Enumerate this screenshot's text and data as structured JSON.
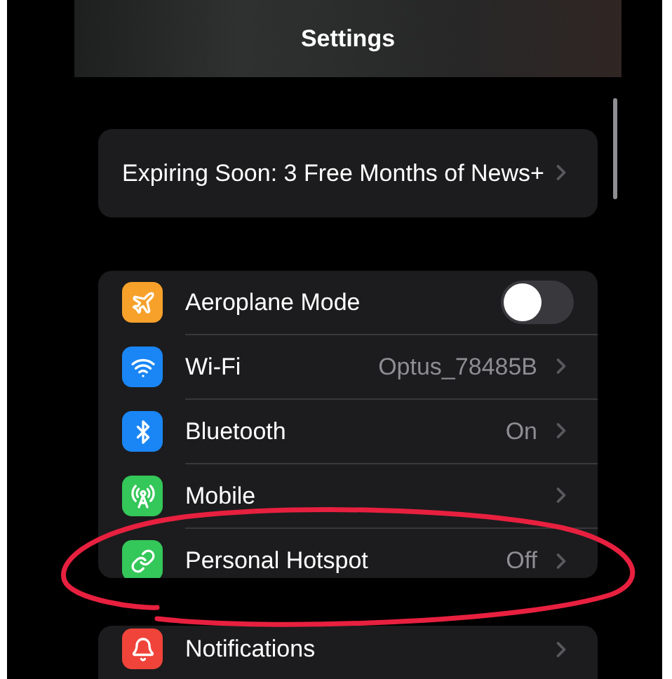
{
  "header": {
    "title": "Settings"
  },
  "promo": {
    "text": "Expiring Soon: 3 Free Months of News+"
  },
  "connectivity": [
    {
      "kind": "toggle",
      "label": "Aeroplane Mode",
      "color": "#f7a12b",
      "on": false
    },
    {
      "kind": "link",
      "label": "Wi-Fi",
      "color": "#1a86f5",
      "value": "Optus_78485B"
    },
    {
      "kind": "link",
      "label": "Bluetooth",
      "color": "#1a86f5",
      "value": "On"
    },
    {
      "kind": "link",
      "label": "Mobile",
      "color": "#34c759"
    },
    {
      "kind": "link",
      "label": "Personal Hotspot",
      "color": "#34c759",
      "value": "Off"
    }
  ],
  "next_group": [
    {
      "kind": "link",
      "label": "Notifications",
      "color": "#f0443a"
    }
  ]
}
